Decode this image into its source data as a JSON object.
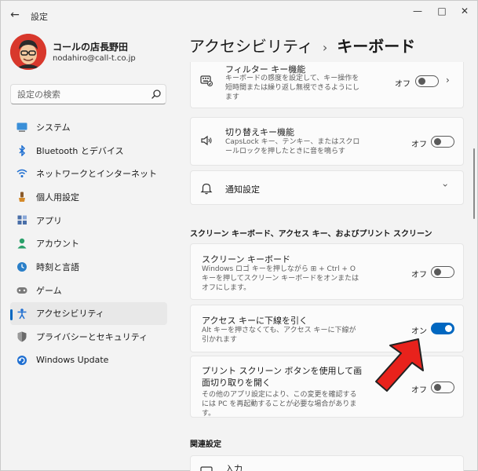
{
  "window": {
    "title": "設定"
  },
  "titlebar": {
    "back_icon": "←",
    "minimize": "—",
    "maximize": "□",
    "close": "✕"
  },
  "profile": {
    "name": "コールの店長野田",
    "email": "nodahiro@call-t.co.jp"
  },
  "search": {
    "placeholder": "設定の検索"
  },
  "nav": {
    "items": [
      {
        "label": "システム",
        "icon": "monitor-icon",
        "color": "#3a8fd8"
      },
      {
        "label": "Bluetooth とデバイス",
        "icon": "bluetooth-icon",
        "color": "#1f6fd1"
      },
      {
        "label": "ネットワークとインターネット",
        "icon": "wifi-icon",
        "color": "#1f6fd1"
      },
      {
        "label": "個人用設定",
        "icon": "brush-icon",
        "color": "#d58a2a"
      },
      {
        "label": "アプリ",
        "icon": "apps-icon",
        "color": "#4a6fa8"
      },
      {
        "label": "アカウント",
        "icon": "person-icon",
        "color": "#2aa06a"
      },
      {
        "label": "時刻と言語",
        "icon": "globe-clock-icon",
        "color": "#2a7fc8"
      },
      {
        "label": "ゲーム",
        "icon": "gamepad-icon",
        "color": "#7a7a7a"
      },
      {
        "label": "アクセシビリティ",
        "icon": "accessibility-icon",
        "color": "#1f6fd1",
        "active": true
      },
      {
        "label": "プライバシーとセキュリティ",
        "icon": "shield-icon",
        "color": "#6a6a6a"
      },
      {
        "label": "Windows Update",
        "icon": "update-icon",
        "color": "#1f6fd1"
      }
    ]
  },
  "header": {
    "parent": "アクセシビリティ",
    "separator": "›",
    "current": "キーボード"
  },
  "cards": {
    "filter_keys": {
      "title": "フィルター キー機能",
      "desc": "キーボードの感度を設定して、キー操作を短時間または繰り返し無視できるようにします",
      "state": "オフ"
    },
    "toggle_keys": {
      "title": "切り替えキー機能",
      "desc": "CapsLock キー、テンキー、またはスクロールロックを押したときに音を鳴らす",
      "state": "オフ"
    },
    "notifications": {
      "title": "通知設定"
    },
    "onscreen_keyboard": {
      "title": "スクリーン キーボード",
      "desc": "Windows ロゴ キーを押しながら ⊞ + Ctrl + O キーを押してスクリーン キーボードをオンまたはオフにします。",
      "state": "オフ"
    },
    "underline_access_keys": {
      "title": "アクセス キーに下線を引く",
      "desc": "Alt キーを押さなくても、アクセス キーに下線が引かれます",
      "state": "オン"
    },
    "print_screen": {
      "title": "プリント スクリーン ボタンを使用して画面切り取りを開く",
      "desc": "その他のアプリ設定により、この変更を確認するには PC を再起動することが必要な場合があります。",
      "state": "オフ"
    },
    "input": {
      "title": "入力"
    }
  },
  "sections": {
    "screen_keyboard": "スクリーン キーボード、アクセス キー、およびプリント スクリーン",
    "related": "関連設定"
  },
  "colors": {
    "accent": "#0067c0",
    "arrow_fill": "#e8221c"
  }
}
